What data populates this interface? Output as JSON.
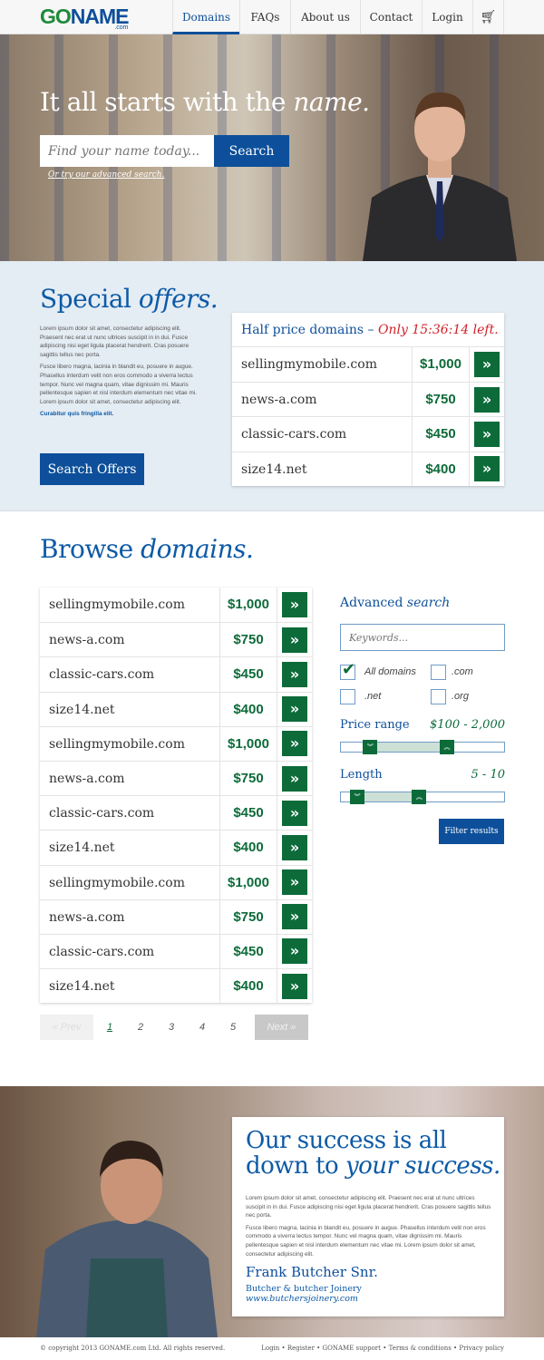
{
  "nav": {
    "logo": "GONAME",
    "logo_sub": ".com",
    "items": [
      "Domains",
      "FAQs",
      "About us",
      "Contact",
      "Login"
    ],
    "active": "Domains",
    "cart_icon": "cart-icon"
  },
  "hero": {
    "headline": "It all starts with the",
    "headline_em": "name.",
    "search_placeholder": "Find your name today...",
    "search_button": "Search",
    "advanced_link": "Or try our advanced search."
  },
  "offers": {
    "title": "Special",
    "title_em": "offers.",
    "para1": "Lorem ipsum dolor sit amet, consectetur adipiscing elit. Praesent nec erat ut nunc ultrices suscipit in in dui. Fusce adipiscing nisi eget ligula placerat hendrerit. Cras posuere sagittis tellus nec porta.",
    "para2": "Fusce libero magna, lacinia in blandit eu, posuere in augue. Phasellus interdum velit non eros commodo a viverra lectus tempor. Nunc vel magna quam, vitae dignissim mi. Mauris pellentesque sapien et nisl interdum elementum nec vitae mi. Lorem ipsum dolor sit amet, consectetur adipiscing elit.",
    "link": "Curabitur quis fringilla elit.",
    "button": "Search Offers",
    "table_title": "Half price domains –",
    "table_timer": "Only 15:36:14 left.",
    "rows": [
      {
        "domain": "sellingmymobile.com",
        "price": "$1,000"
      },
      {
        "domain": "news-a.com",
        "price": "$750"
      },
      {
        "domain": "classic-cars.com",
        "price": "$450"
      },
      {
        "domain": "size14.net",
        "price": "$400"
      }
    ]
  },
  "browse": {
    "title": "Browse",
    "title_em": "domains.",
    "button_glyph": "»",
    "rows": [
      {
        "domain": "sellingmymobile.com",
        "price": "$1,000"
      },
      {
        "domain": "news-a.com",
        "price": "$750"
      },
      {
        "domain": "classic-cars.com",
        "price": "$450"
      },
      {
        "domain": "size14.net",
        "price": "$400"
      },
      {
        "domain": "sellingmymobile.com",
        "price": "$1,000"
      },
      {
        "domain": "news-a.com",
        "price": "$750"
      },
      {
        "domain": "classic-cars.com",
        "price": "$450"
      },
      {
        "domain": "size14.net",
        "price": "$400"
      },
      {
        "domain": "sellingmymobile.com",
        "price": "$1,000"
      },
      {
        "domain": "news-a.com",
        "price": "$750"
      },
      {
        "domain": "classic-cars.com",
        "price": "$450"
      },
      {
        "domain": "size14.net",
        "price": "$400"
      }
    ],
    "pagination": {
      "prev": "« Prev",
      "next": "Next »",
      "pages": [
        "1",
        "2",
        "3",
        "4",
        "5"
      ],
      "current": "1"
    }
  },
  "advanced": {
    "title": "Advanced",
    "title_em": "search",
    "keywords_placeholder": "Keywords...",
    "checkboxes": [
      {
        "label": "All domains",
        "checked": true
      },
      {
        "label": ".com",
        "checked": false
      },
      {
        "label": ".net",
        "checked": false
      },
      {
        "label": ".org",
        "checked": false
      }
    ],
    "price": {
      "label": "Price range",
      "value": "$100 - 2,000",
      "low_pct": 18,
      "high_pct": 65
    },
    "length": {
      "label": "Length",
      "value": "5 - 10",
      "low_pct": 10,
      "high_pct": 48
    },
    "filter_button": "Filter results"
  },
  "testimonial": {
    "line1": "Our success is all",
    "line2": "down to",
    "line2_em": "your success.",
    "para1": "Lorem ipsum dolor sit amet, consectetur adipiscing elit. Praesent nec erat ut nunc ultrices suscipit in in dui. Fusce adipiscing nisi eget ligula placerat hendrerit. Cras posuere sagittis tellus nec porta.",
    "para2": "Fusce libero magna, lacinia in blandit eu, posuere in augue. Phasellus interdum velit non eros commodo a viverra lectus tempor. Nunc vel magna quam, vitae dignissim mi. Mauris pellentesque sapien et nisl interdum elementum nec vitae mi. Lorem ipsum dolor sit amet, consectetur adipiscing elit.",
    "name": "Frank Butcher Snr.",
    "company": "Butcher & butcher Joinery",
    "website": "www.butchersjoinery.com"
  },
  "footer": {
    "copyright": "© copyright 2013 GONAME.com Ltd. All rights reserved.",
    "links": [
      "Login",
      "Register",
      "GONAME support",
      "Terms & conditions",
      "Privacy policy"
    ]
  }
}
